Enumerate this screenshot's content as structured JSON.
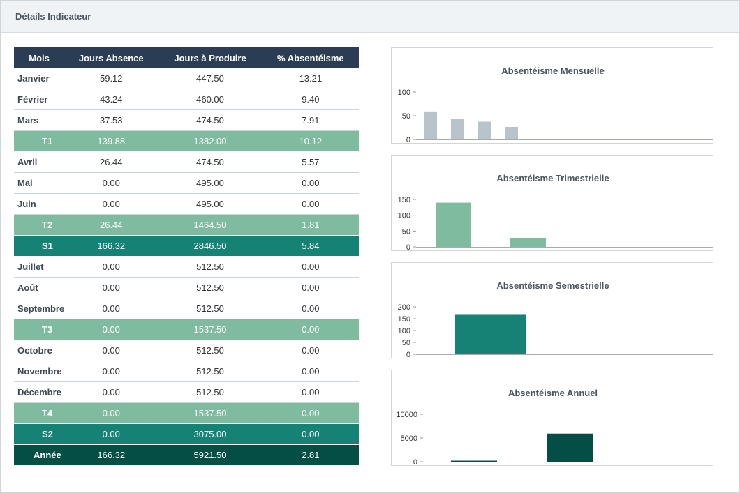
{
  "panel": {
    "title": "Détails Indicateur"
  },
  "table": {
    "headers": [
      "Mois",
      "Jours Absence",
      "Jours à Produire",
      "% Absentéisme"
    ],
    "rows": [
      {
        "type": "month",
        "label": "Janvier",
        "absence": "59.12",
        "produire": "447.50",
        "pct": "13.21"
      },
      {
        "type": "month",
        "label": "Février",
        "absence": "43.24",
        "produire": "460.00",
        "pct": "9.40"
      },
      {
        "type": "month",
        "label": "Mars",
        "absence": "37.53",
        "produire": "474.50",
        "pct": "7.91"
      },
      {
        "type": "quarter",
        "label": "T1",
        "absence": "139.88",
        "produire": "1382.00",
        "pct": "10.12"
      },
      {
        "type": "month",
        "label": "Avril",
        "absence": "26.44",
        "produire": "474.50",
        "pct": "5.57"
      },
      {
        "type": "month",
        "label": "Mai",
        "absence": "0.00",
        "produire": "495.00",
        "pct": "0.00"
      },
      {
        "type": "month",
        "label": "Juin",
        "absence": "0.00",
        "produire": "495.00",
        "pct": "0.00"
      },
      {
        "type": "quarter",
        "label": "T2",
        "absence": "26.44",
        "produire": "1464.50",
        "pct": "1.81"
      },
      {
        "type": "semester",
        "label": "S1",
        "absence": "166.32",
        "produire": "2846.50",
        "pct": "5.84"
      },
      {
        "type": "month",
        "label": "Juillet",
        "absence": "0.00",
        "produire": "512.50",
        "pct": "0.00"
      },
      {
        "type": "month",
        "label": "Août",
        "absence": "0.00",
        "produire": "512.50",
        "pct": "0.00"
      },
      {
        "type": "month",
        "label": "Septembre",
        "absence": "0.00",
        "produire": "512.50",
        "pct": "0.00"
      },
      {
        "type": "quarter",
        "label": "T3",
        "absence": "0.00",
        "produire": "1537.50",
        "pct": "0.00"
      },
      {
        "type": "month",
        "label": "Octobre",
        "absence": "0.00",
        "produire": "512.50",
        "pct": "0.00"
      },
      {
        "type": "month",
        "label": "Novembre",
        "absence": "0.00",
        "produire": "512.50",
        "pct": "0.00"
      },
      {
        "type": "month",
        "label": "Décembre",
        "absence": "0.00",
        "produire": "512.50",
        "pct": "0.00"
      },
      {
        "type": "quarter",
        "label": "T4",
        "absence": "0.00",
        "produire": "1537.50",
        "pct": "0.00"
      },
      {
        "type": "semester",
        "label": "S2",
        "absence": "0.00",
        "produire": "3075.00",
        "pct": "0.00"
      },
      {
        "type": "year",
        "label": "Année",
        "absence": "166.32",
        "produire": "5921.50",
        "pct": "2.81"
      }
    ]
  },
  "chart_data": [
    {
      "type": "bar",
      "title": "Absentéisme Mensuelle",
      "values": [
        59.12,
        43.24,
        37.53,
        26.44,
        0,
        0,
        0,
        0,
        0,
        0,
        0,
        0
      ],
      "ylim": [
        0,
        100
      ],
      "yticks": [
        "0",
        "50",
        "100"
      ],
      "color": "#b9c4ca"
    },
    {
      "type": "bar",
      "title": "Absentéisme Trimestrielle",
      "values": [
        139.88,
        26.44,
        0,
        0
      ],
      "ylim": [
        0,
        150
      ],
      "yticks": [
        "0",
        "50",
        "100",
        "150"
      ],
      "color": "#7fbb9e"
    },
    {
      "type": "bar",
      "title": "Absentéisme Semestrielle",
      "values": [
        166.32,
        0
      ],
      "ylim": [
        0,
        200
      ],
      "yticks": [
        "0",
        "50",
        "100",
        "150",
        "200"
      ],
      "color": "#158275"
    },
    {
      "type": "bar",
      "title": "Absentéisme Annuel",
      "values": [
        166.32,
        5921.5
      ],
      "ylim": [
        0,
        10000
      ],
      "yticks": [
        "0",
        "5000",
        "10000"
      ],
      "color": "#054e46"
    }
  ]
}
